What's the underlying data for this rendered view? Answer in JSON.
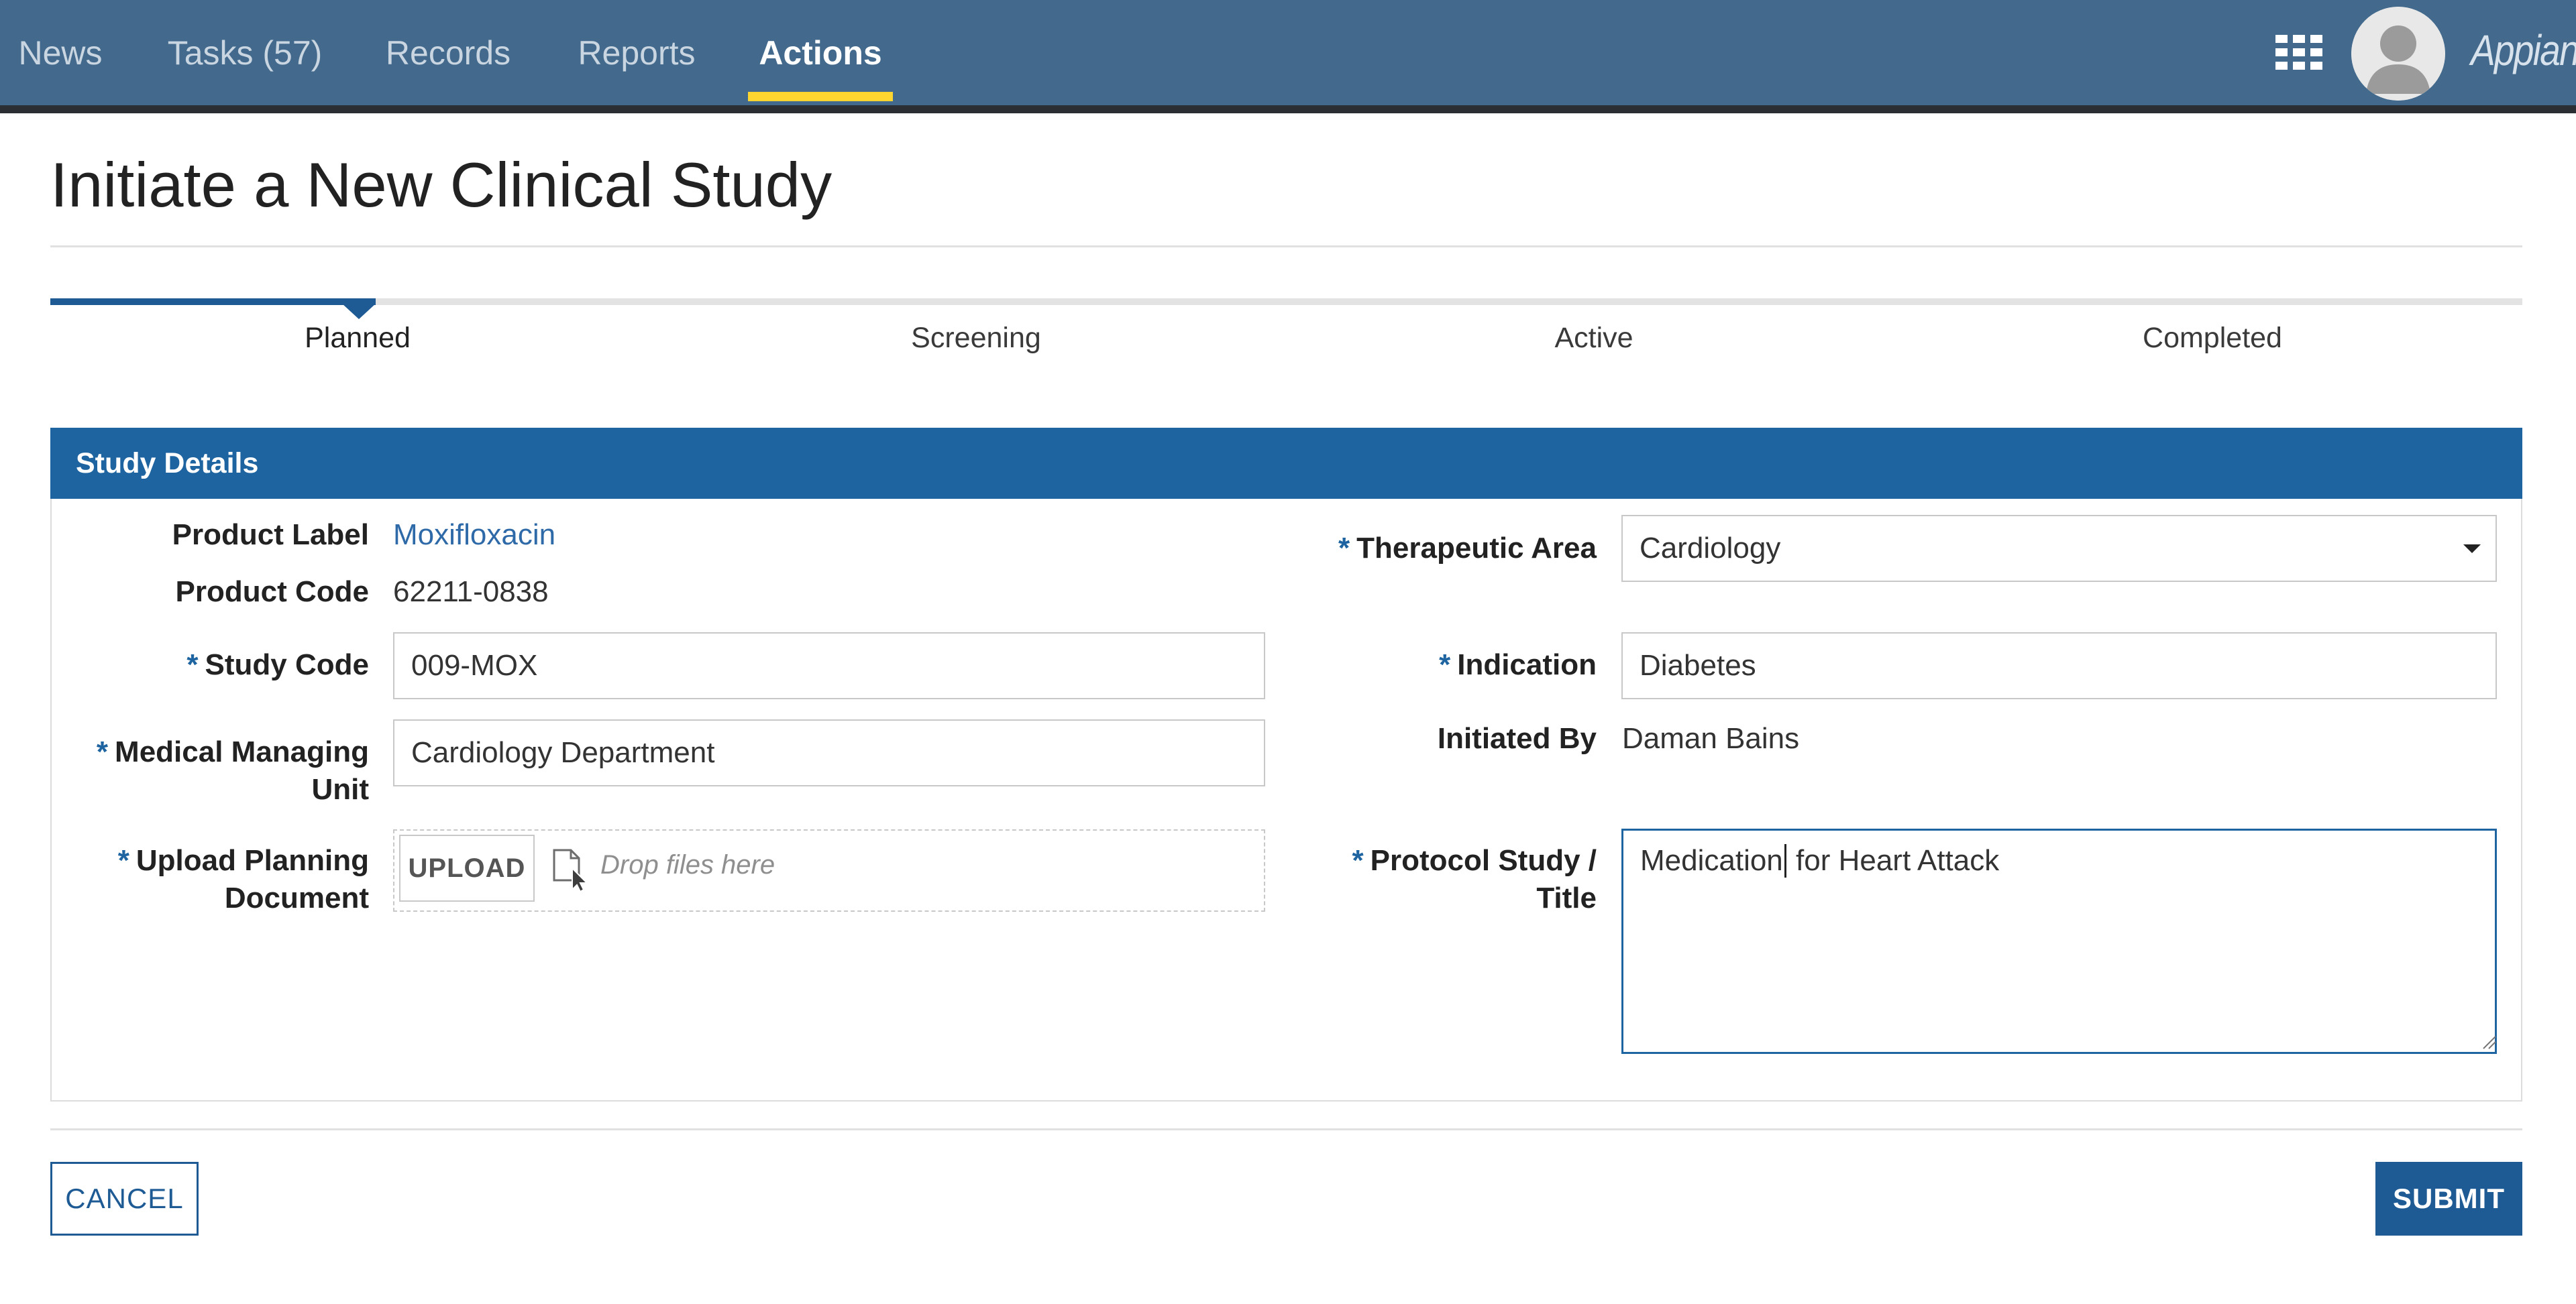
{
  "nav": {
    "tabs": [
      {
        "label": "News"
      },
      {
        "label": "Tasks (57)"
      },
      {
        "label": "Records"
      },
      {
        "label": "Reports"
      },
      {
        "label": "Actions",
        "active": true
      }
    ],
    "apps_icon": "grid-icon",
    "brand": "Appian"
  },
  "page": {
    "title": "Initiate a New Clinical Study"
  },
  "milestone": {
    "current_step": 0,
    "steps": [
      "Planned",
      "Screening",
      "Active",
      "Completed"
    ]
  },
  "section": {
    "title": "Study Details",
    "required_marker": "*",
    "product_label": {
      "label": "Product Label",
      "value": "Moxifloxacin"
    },
    "product_code": {
      "label": "Product Code",
      "value": "62211-0838"
    },
    "study_code": {
      "label": "Study Code",
      "value": "009-MOX"
    },
    "medical_unit": {
      "label_line1": "Medical Managing",
      "label_line2": "Unit",
      "value": "Cardiology Department"
    },
    "upload": {
      "label_line1": "Upload Planning",
      "label_line2": "Document",
      "button": "UPLOAD",
      "drop_text": "Drop files here"
    },
    "therapeutic_area": {
      "label": "Therapeutic Area",
      "value": "Cardiology"
    },
    "indication": {
      "label": "Indication",
      "value": "Diabetes"
    },
    "initiated_by": {
      "label": "Initiated By",
      "value": "Daman Bains"
    },
    "protocol": {
      "label_line1": "Protocol Study /",
      "label_line2": "Title",
      "value_before_cursor": "Medication",
      "value_after_cursor": " for Heart Attack"
    }
  },
  "footer": {
    "cancel": "CANCEL",
    "submit": "SUBMIT"
  },
  "colors": {
    "header": "#436a8d",
    "accent": "#1e64a0",
    "active_underline": "#ffd530"
  }
}
